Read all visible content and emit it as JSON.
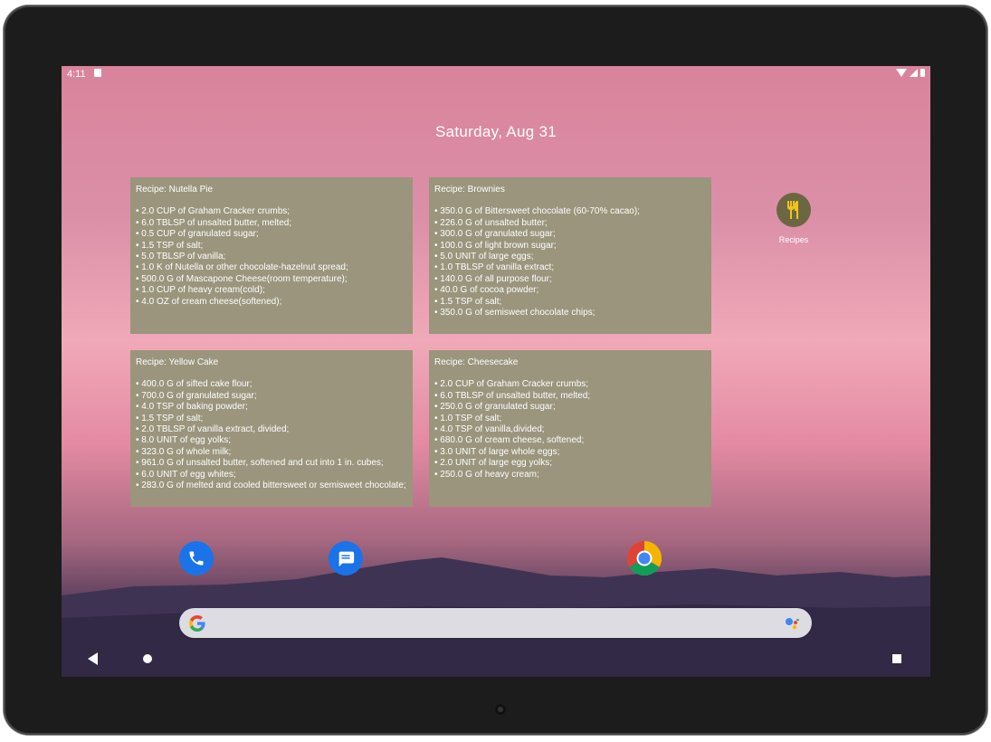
{
  "status": {
    "time": "4:11"
  },
  "date": "Saturday, Aug 31",
  "widgets": [
    {
      "title": "Recipe: Nutella Pie",
      "items": [
        "2.0 CUP of Graham Cracker crumbs;",
        "6.0 TBLSP of unsalted butter, melted;",
        "0.5 CUP of granulated sugar;",
        "1.5 TSP of salt;",
        "5.0 TBLSP of vanilla;",
        "1.0 K of Nutella or other chocolate-hazelnut spread;",
        "500.0 G of Mascapone Cheese(room temperature);",
        "1.0 CUP of heavy cream(cold);",
        "4.0 OZ of cream cheese(softened);"
      ]
    },
    {
      "title": "Recipe: Brownies",
      "items": [
        "350.0 G of Bittersweet chocolate (60-70% cacao);",
        "226.0 G of unsalted butter;",
        "300.0 G of granulated sugar;",
        "100.0 G of light brown sugar;",
        "5.0 UNIT of large eggs;",
        "1.0 TBLSP of vanilla extract;",
        "140.0 G of all purpose flour;",
        "40.0 G of cocoa powder;",
        "1.5 TSP of salt;",
        "350.0 G of semisweet chocolate chips;"
      ]
    },
    {
      "title": "Recipe: Yellow Cake",
      "items": [
        "400.0 G of sifted cake flour;",
        "700.0 G of granulated sugar;",
        "4.0 TSP of baking powder;",
        "1.5 TSP of salt;",
        "2.0 TBLSP of vanilla extract, divided;",
        "8.0 UNIT of egg yolks;",
        "323.0 G of whole milk;",
        "961.0 G of unsalted butter, softened and cut into 1 in. cubes;",
        "6.0 UNIT of egg whites;",
        "283.0 G of melted and cooled bittersweet or semisweet chocolate;"
      ]
    },
    {
      "title": "Recipe: Cheesecake",
      "items": [
        "2.0 CUP of Graham Cracker crumbs;",
        "6.0 TBLSP of unsalted butter, melted;",
        "250.0 G of granulated sugar;",
        "1.0 TSP of salt;",
        "4.0 TSP of vanilla,divided;",
        "680.0 G of cream cheese, softened;",
        "3.0 UNIT of large whole eggs;",
        "2.0 UNIT of large egg yolks;",
        "250.0 G of heavy cream;"
      ]
    }
  ],
  "app": {
    "label": "Recipes",
    "icon": "fork-knife-icon"
  },
  "dock": [
    {
      "icon": "phone-icon",
      "color": "#1a73e8"
    },
    {
      "icon": "messages-icon",
      "color": "#1a73e8"
    },
    {
      "icon": "chrome-icon"
    }
  ],
  "colors": {
    "widget_bg": "#9a957c",
    "app_icon_bg": "#6b6743"
  }
}
